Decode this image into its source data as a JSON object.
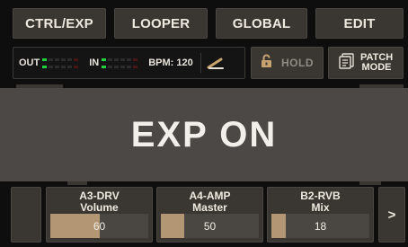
{
  "tabs": [
    {
      "label": "CTRL/EXP"
    },
    {
      "label": "LOOPER"
    },
    {
      "label": "GLOBAL"
    },
    {
      "label": "EDIT"
    }
  ],
  "status": {
    "out_label": "OUT",
    "in_label": "IN",
    "bpm_text": "BPM: 120",
    "icons": [
      "tuner-fork-icon"
    ]
  },
  "hold": {
    "label": "HOLD",
    "icon": "lock-icon"
  },
  "patch_mode": {
    "label": "PATCH MODE",
    "line1": "PATCH",
    "line2": "MODE",
    "icon": "patch-list-icon"
  },
  "overlay": {
    "text": "EXP ON"
  },
  "params": [
    {
      "block": "A3-DRV",
      "name": "Volume",
      "value": "60",
      "level": 0.5
    },
    {
      "block": "A4-AMP",
      "name": "Master",
      "value": "50",
      "level": 0.24
    },
    {
      "block": "B2-RVB",
      "name": "Mix",
      "value": "18",
      "level": 0.15
    }
  ],
  "nav": {
    "next_label": ">"
  },
  "colors": {
    "accent_green": "#22d13b",
    "bar_fill": "#b39674",
    "button_bg": "#3a3733",
    "overlay_bg": "#4c4845"
  }
}
